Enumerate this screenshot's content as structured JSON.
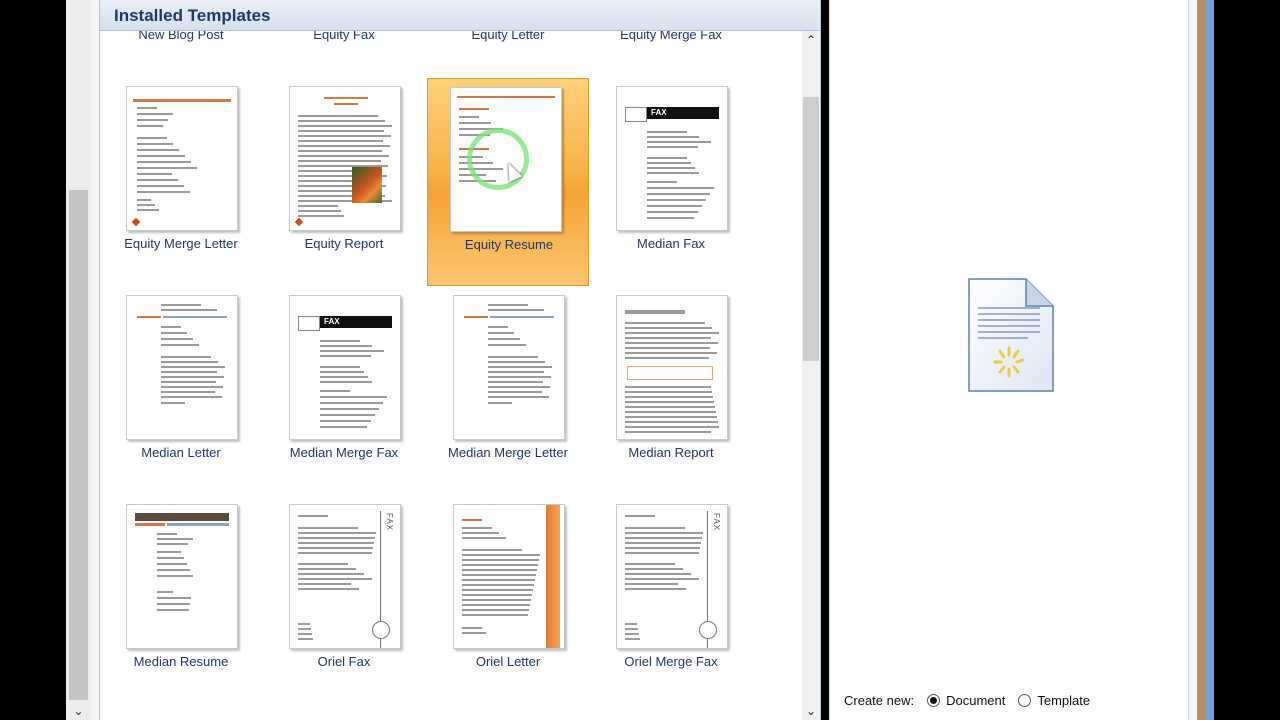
{
  "gallery": {
    "title": "Installed Templates",
    "templates": [
      {
        "label": "New Blog Post",
        "thumb": "blog",
        "selected": false
      },
      {
        "label": "Equity Fax",
        "thumb": "equity-fax",
        "selected": false
      },
      {
        "label": "Equity Letter",
        "thumb": "equity-letter",
        "selected": false
      },
      {
        "label": "Equity Merge Fax",
        "thumb": "equity-merge-fax",
        "selected": false
      },
      {
        "label": "Equity Merge Letter",
        "thumb": "equity-merge-letter",
        "selected": false
      },
      {
        "label": "Equity Report",
        "thumb": "equity-report",
        "selected": false
      },
      {
        "label": "Equity Resume",
        "thumb": "equity-resume",
        "selected": true
      },
      {
        "label": "Median Fax",
        "thumb": "median-fax",
        "selected": false
      },
      {
        "label": "Median Letter",
        "thumb": "median-letter",
        "selected": false
      },
      {
        "label": "Median Merge Fax",
        "thumb": "median-merge-fax",
        "selected": false
      },
      {
        "label": "Median Merge Letter",
        "thumb": "median-merge-letter",
        "selected": false
      },
      {
        "label": "Median Report",
        "thumb": "median-report",
        "selected": false
      },
      {
        "label": "Median Resume",
        "thumb": "median-resume",
        "selected": false
      },
      {
        "label": "Oriel Fax",
        "thumb": "oriel-fax",
        "selected": false
      },
      {
        "label": "Oriel Letter",
        "thumb": "oriel-letter",
        "selected": false
      },
      {
        "label": "Oriel Merge Fax",
        "thumb": "oriel-merge-fax",
        "selected": false
      }
    ],
    "fax_thumb_text": "FAX",
    "vertical_fax_text": "FAX"
  },
  "scrollbar": {
    "up_icon": "chevron-up-icon",
    "down_icon": "chevron-down-icon"
  },
  "preview": {
    "icon": "loading-document-icon",
    "create_new_label": "Create new:",
    "options": [
      {
        "label": "Document",
        "checked": true
      },
      {
        "label": "Template",
        "checked": false
      }
    ]
  },
  "colors": {
    "selection": "#f8b248",
    "title": "#1d3a6e",
    "accent_orange": "#e47a2c"
  }
}
